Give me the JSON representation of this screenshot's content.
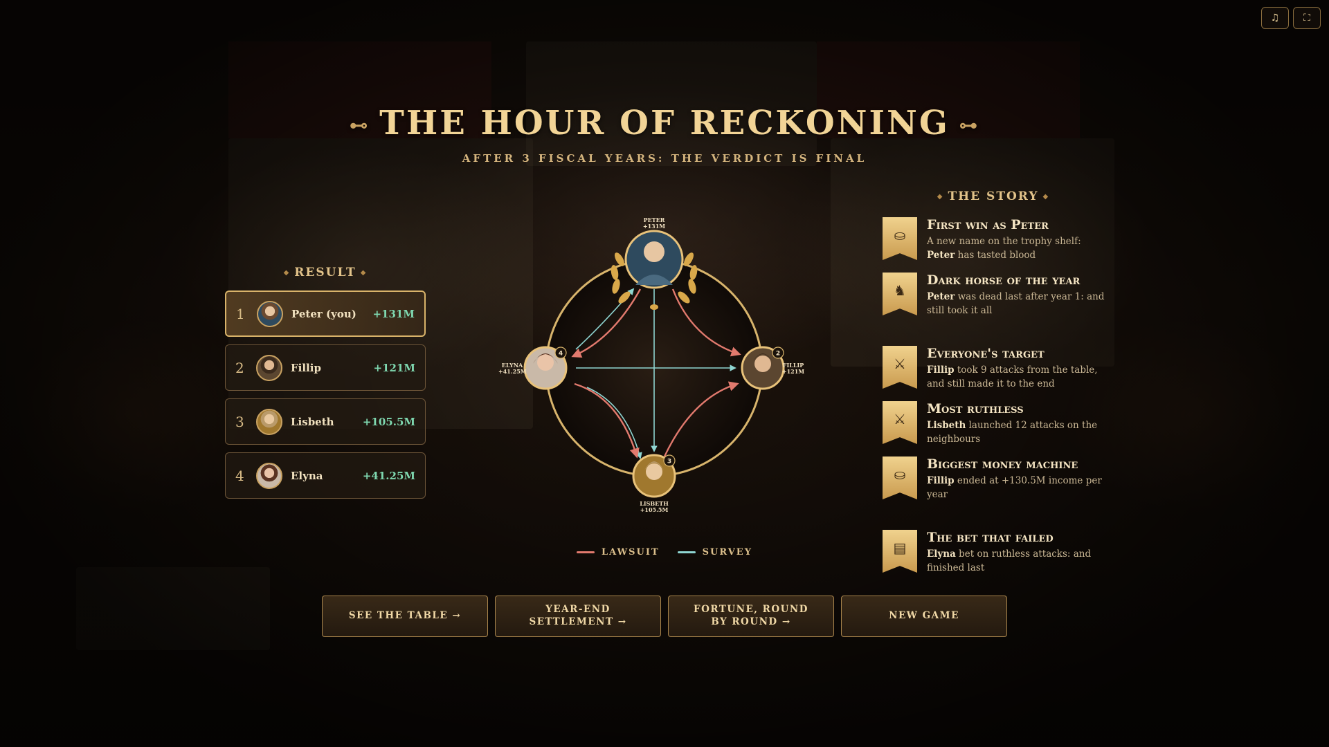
{
  "header": {
    "title": "THE HOUR OF RECKONING",
    "ornament_left": "⊷",
    "ornament_right": "⊶",
    "subtitle": "AFTER 3 FISCAL YEARS: THE VERDICT IS FINAL"
  },
  "top_controls": [
    {
      "icon": "music-note-icon",
      "glyph": "♫"
    },
    {
      "icon": "fullscreen-icon",
      "glyph": "⛶"
    }
  ],
  "result": {
    "heading": "RESULT",
    "rows": [
      {
        "rank": "1",
        "name": "Peter (you)",
        "score": "+131M"
      },
      {
        "rank": "2",
        "name": "Fillip",
        "score": "+121M"
      },
      {
        "rank": "3",
        "name": "Lisbeth",
        "score": "+105.5M"
      },
      {
        "rank": "4",
        "name": "Elyna",
        "score": "+41.25M"
      }
    ]
  },
  "diagram": {
    "nodes": [
      {
        "name": "PETER",
        "score": "+131M",
        "badge": ""
      },
      {
        "name": "FILLIP",
        "score": "+121M",
        "badge": "2"
      },
      {
        "name": "LISBETH",
        "score": "+105.5M",
        "badge": "3"
      },
      {
        "name": "ELYNA",
        "score": "+41.25M",
        "badge": "4"
      }
    ],
    "legend": [
      {
        "label": "LAWSUIT",
        "color": "#e27a6e"
      },
      {
        "label": "SURVEY",
        "color": "#8fd6d2"
      }
    ]
  },
  "story": {
    "heading": "THE STORY",
    "items": [
      {
        "icon": "money-bag-icon",
        "glyph": "💰",
        "title": "First win as Peter",
        "desc_pre": "A new name on the trophy shelf: ",
        "desc_bold": "Peter",
        "desc_post": " has tasted blood",
        "bold_first": false
      },
      {
        "icon": "chess-knight-icon",
        "glyph": "♞",
        "title": "Dark horse of the year",
        "desc_bold": "Peter",
        "desc_post": " was dead last after year 1: and still took it all",
        "bold_first": true
      },
      {
        "icon": "crossed-swords-icon",
        "glyph": "⚔",
        "title": "Everyone's target",
        "desc_bold": "Fillip",
        "desc_post": " took 9 attacks from the table, and still made it to the end",
        "bold_first": true
      },
      {
        "icon": "crossed-swords-icon",
        "glyph": "⚔",
        "title": "Most ruthless",
        "desc_bold": "Lisbeth",
        "desc_post": " launched 12 attacks on the neighbours",
        "bold_first": true
      },
      {
        "icon": "money-bag-icon",
        "glyph": "💰",
        "title": "Biggest money machine",
        "desc_bold": "Fillip",
        "desc_post": " ended at +130.5M income per year",
        "bold_first": true
      },
      {
        "icon": "ledger-icon",
        "glyph": "▤",
        "title": "The bet that failed",
        "desc_bold": "Elyna",
        "desc_post": " bet on ruthless attacks: and finished last",
        "bold_first": true
      }
    ]
  },
  "actions": [
    {
      "label": "SEE THE TABLE →"
    },
    {
      "label": "YEAR-END SETTLEMENT →"
    },
    {
      "label": "FORTUNE, ROUND BY ROUND →"
    },
    {
      "label": "NEW GAME"
    }
  ]
}
